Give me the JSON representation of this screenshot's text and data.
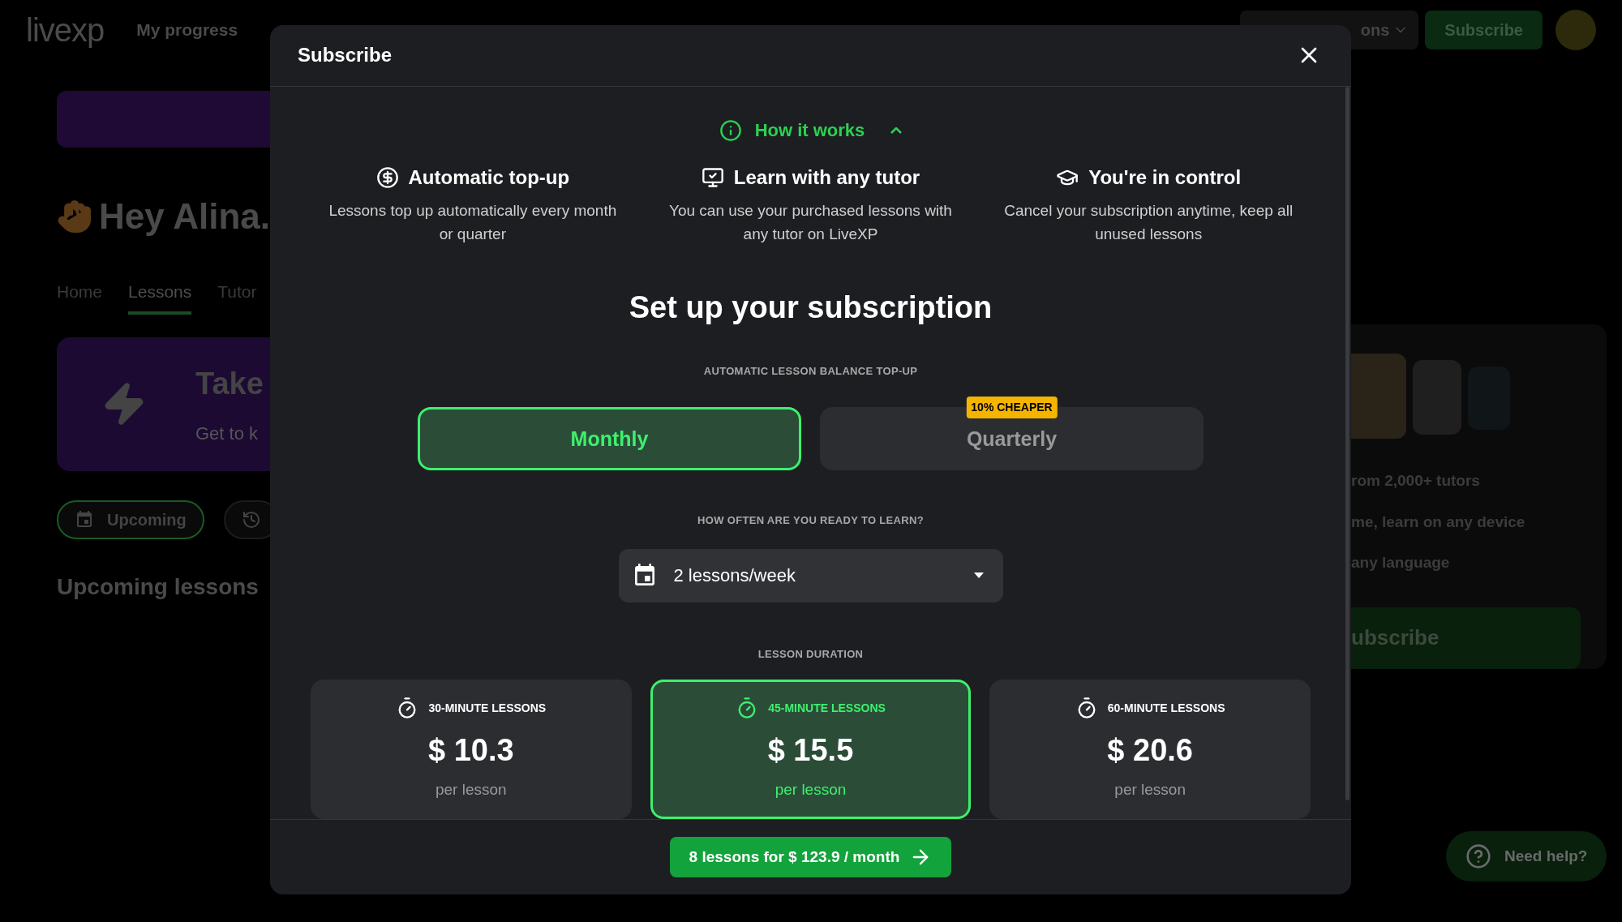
{
  "background": {
    "logo": "livexp",
    "nav": [
      "My progress"
    ],
    "lessons_dropdown": "ons",
    "subscribe_button": "Subscribe",
    "greeting": "Hey Alina.",
    "tabs": [
      {
        "label": "Home",
        "selected": false
      },
      {
        "label": "Lessons",
        "selected": true
      },
      {
        "label": "Tutor",
        "selected": false
      }
    ],
    "promo": {
      "title": "Take",
      "subtitle": "Get to k"
    },
    "filters": [
      {
        "kind": "calendar",
        "label": "Upcoming",
        "selected": true
      },
      {
        "kind": "history",
        "selected": false
      }
    ],
    "section_title": "Upcoming lessons",
    "side_card": {
      "features": [
        "rom 2,000+ tutors",
        "me, learn on any device",
        "any language"
      ],
      "button": "ubscribe"
    },
    "help_button": "Need help?"
  },
  "modal": {
    "title": "Subscribe",
    "how_it_works": {
      "label": "How it works",
      "expanded": true
    },
    "features": [
      {
        "kind": "top-up",
        "title": "Automatic top-up",
        "text": "Lessons top up automatically every month or quarter"
      },
      {
        "kind": "tutor",
        "title": "Learn with any tutor",
        "text": "You can use your purchased lessons with any tutor on LiveXP"
      },
      {
        "kind": "control",
        "title": "You're in control",
        "text": "Cancel your subscription anytime, keep all unused lessons"
      }
    ],
    "heading": "Set up your subscription",
    "period_label": "AUTOMATIC LESSON BALANCE TOP-UP",
    "periods": [
      {
        "label": "Monthly",
        "selected": true
      },
      {
        "label": "Quarterly",
        "selected": false,
        "badge": "10% CHEAPER"
      }
    ],
    "frequency_label": "HOW OFTEN ARE YOU READY TO LEARN?",
    "frequency": {
      "value": "2 lessons/week"
    },
    "duration_label": "LESSON DURATION",
    "durations": [
      {
        "label": "30-MINUTE LESSONS",
        "price": "$ 10.3",
        "unit": "per lesson",
        "selected": false
      },
      {
        "label": "45-MINUTE LESSONS",
        "price": "$ 15.5",
        "unit": "per lesson",
        "selected": true
      },
      {
        "label": "60-MINUTE LESSONS",
        "price": "$ 20.6",
        "unit": "per lesson",
        "selected": false
      }
    ],
    "cta": "8 lessons for $ 123.9 / month"
  }
}
